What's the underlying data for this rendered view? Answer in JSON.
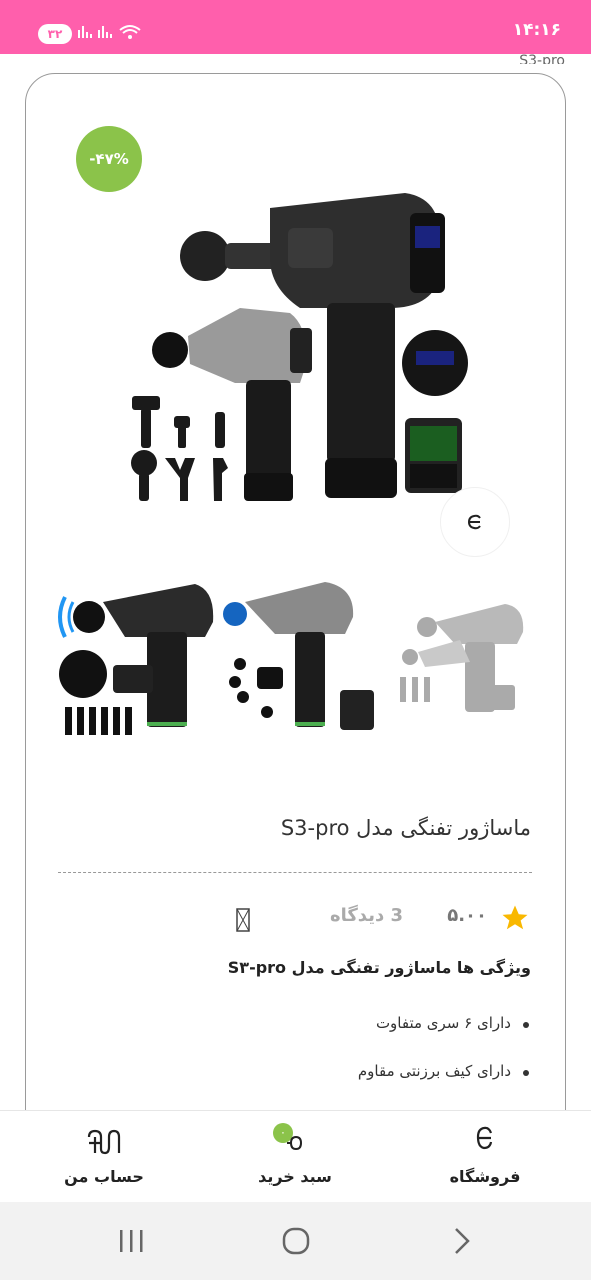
{
  "status_bar": {
    "time": "۱۴:۱۶",
    "notification_count": "۳۲"
  },
  "partial_text": "S3-pro",
  "product": {
    "discount": "-۴۷%",
    "title": "ماساژور تفنگی مدل S3-pro",
    "rating": "۵.۰۰",
    "reviews": "3 دیدگاه",
    "features_title": "ویژگی ها ماساژور تفنگی مدل S۳-pro",
    "features": [
      "دارای ۶ سری متفاوت",
      "دارای کیف برزنتی مقاوم"
    ]
  },
  "bottom_nav": {
    "shop_label": "فروشگاه",
    "cart_label": "سبد خرید",
    "cart_count": "۰",
    "account_label": "حساب من"
  },
  "colors": {
    "status_bar": "#ff5fac",
    "accent_green": "#8bc34a",
    "star": "#f9b800"
  },
  "icons": {
    "zoom": "zoom-icon",
    "star": "star-icon",
    "bookmark": "bookmark-icon",
    "shop": "shop-icon",
    "cart": "cart-icon",
    "account": "account-icon"
  }
}
